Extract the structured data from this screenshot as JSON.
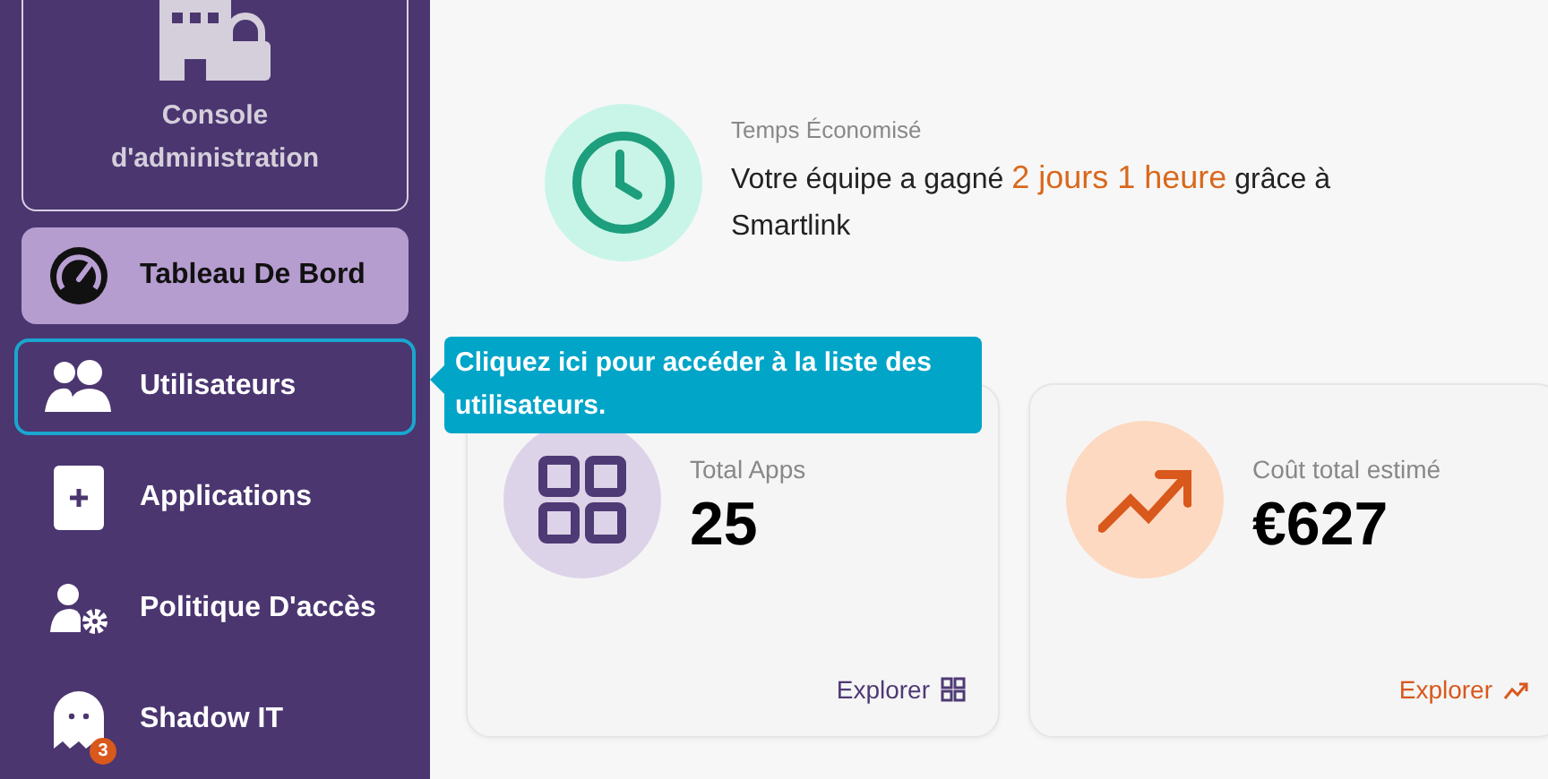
{
  "console": {
    "title": "Console d'administration"
  },
  "nav": [
    {
      "label": "Tableau De Bord",
      "kind": "gauge",
      "selected": true,
      "highlighted": false
    },
    {
      "label": "Utilisateurs",
      "kind": "users",
      "selected": false,
      "highlighted": true
    },
    {
      "label": "Applications",
      "kind": "plus",
      "selected": false,
      "highlighted": false
    },
    {
      "label": "Politique D'accès",
      "kind": "user-gear",
      "selected": false,
      "highlighted": false
    },
    {
      "label": "Shadow IT",
      "kind": "ghost",
      "selected": false,
      "highlighted": false,
      "badge": "3"
    }
  ],
  "time_saved": {
    "label": "Temps Économisé",
    "before": "Votre équipe a gagné",
    "highlight": "2 jours 1 heure",
    "after": "grâce à Smartlink"
  },
  "cards": [
    {
      "kind": "apps",
      "label": "Total Apps",
      "value": "25",
      "link": "Explorer"
    },
    {
      "kind": "cost",
      "label": "Coût total estimé",
      "value": "€627",
      "link": "Explorer"
    }
  ],
  "tooltip": {
    "text": "Cliquez ici pour accéder à la liste des utilisateurs."
  }
}
